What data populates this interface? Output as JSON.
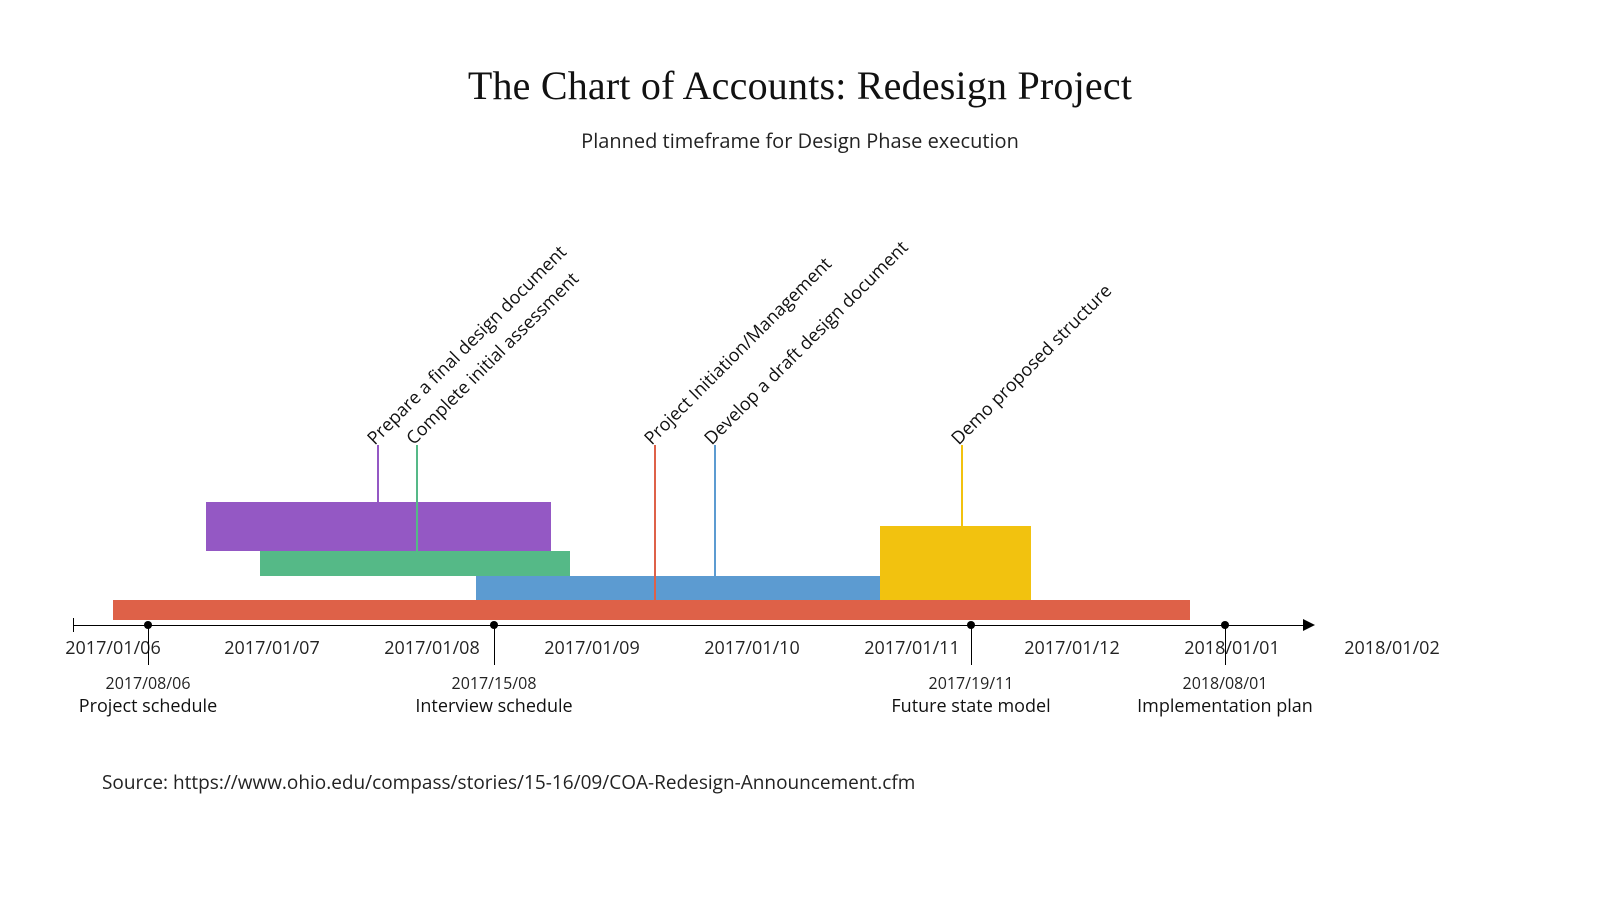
{
  "title": "The Chart of Accounts: Redesign Project",
  "subtitle": "Planned timeframe for Design Phase execution",
  "source": "Source: https://www.ohio.edu/compass/stories/15-16/09/COA-Redesign-Announcement.cfm",
  "chart_data": {
    "type": "bar",
    "title": "The Chart of Accounts: Redesign Project",
    "subtitle": "Planned timeframe for Design Phase execution",
    "xlabel": "",
    "ylabel": "",
    "x_axis_ticks": [
      "2017/01/06",
      "2017/01/07",
      "2017/01/08",
      "2017/01/09",
      "2017/01/10",
      "2017/01/11",
      "2017/01/12",
      "2018/01/01",
      "2018/01/02"
    ],
    "series": [
      {
        "name": "Project Initiation/Management",
        "start": "2017/06",
        "end": "2018/01",
        "color": "#de6148",
        "leader_x": "2017/09/15"
      },
      {
        "name": "Develop a draft design document",
        "start": "2017/08",
        "end": "2017/11",
        "color": "#5c9bd1",
        "leader_x": "2017/10/01"
      },
      {
        "name": "Complete initial assessment",
        "start": "2017/07",
        "end": "2017/09",
        "color": "#55b987",
        "leader_x": "2017/08/05"
      },
      {
        "name": "Prepare a final design document",
        "start": "2017/06/20",
        "end": "2017/08/25",
        "color": "#9458c4",
        "leader_x": "2017/07/25"
      },
      {
        "name": "Demo proposed structure",
        "start": "2017/11/05",
        "end": "2017/12/01",
        "color": "#f2c20f",
        "leader_x": "2017/11/20"
      }
    ],
    "milestones": [
      {
        "date": "2017/08/06",
        "label": "Project schedule"
      },
      {
        "date": "2017/15/08",
        "label": "Interview schedule"
      },
      {
        "date": "2017/19/11",
        "label": "Future state model"
      },
      {
        "date": "2018/08/01",
        "label": "Implementation plan"
      }
    ],
    "xlim": [
      "2017/01/06",
      "2018/01/02"
    ]
  }
}
